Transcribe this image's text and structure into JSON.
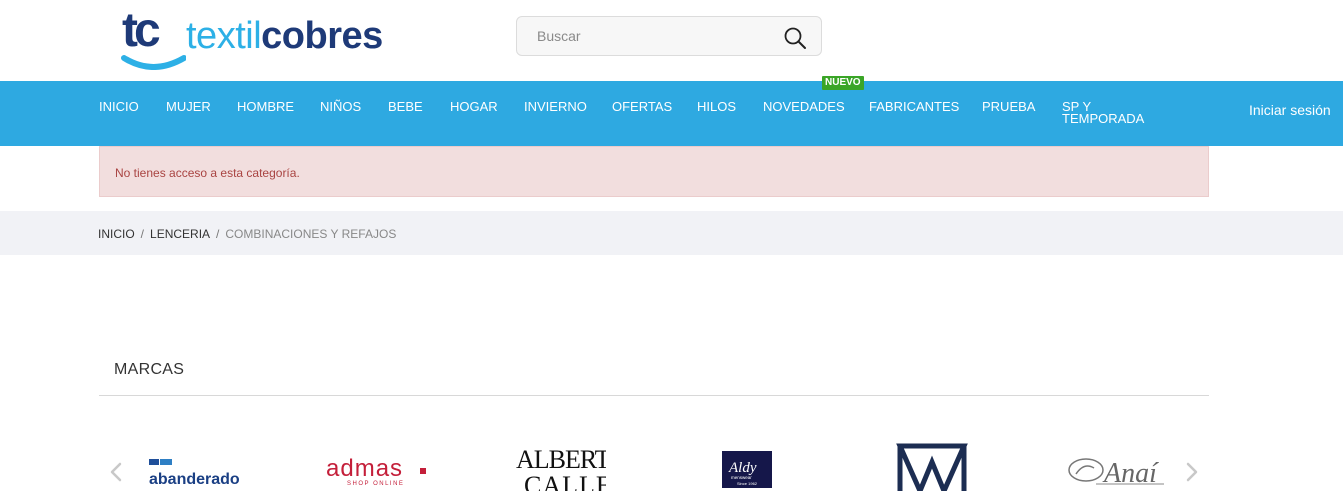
{
  "header": {
    "logo": {
      "monogram": "tc",
      "text_part1": "textil",
      "text_part2": "cobres"
    },
    "search": {
      "placeholder": "Buscar",
      "icon": "search-icon"
    }
  },
  "nav": {
    "items": [
      {
        "label": "INICIO"
      },
      {
        "label": "MUJER"
      },
      {
        "label": "HOMBRE"
      },
      {
        "label": "NIÑOS"
      },
      {
        "label": "BEBE"
      },
      {
        "label": "HOGAR"
      },
      {
        "label": "INVIERNO"
      },
      {
        "label": "OFERTAS"
      },
      {
        "label": "HILOS"
      },
      {
        "label": "NOVEDADES"
      },
      {
        "label": "FABRICANTES"
      },
      {
        "label": "PRUEBA"
      },
      {
        "label": "SP Y TEMPORADA"
      }
    ],
    "badge": "NUEVO",
    "login_label": "Iniciar sesión",
    "colors": {
      "bar": "#2ea9e1",
      "badge": "#3aa527"
    }
  },
  "alert": {
    "message": "No tienes acceso a esta categoría."
  },
  "breadcrumb": {
    "items": [
      "INICIO",
      "LENCERIA",
      "COMBINACIONES Y REFAJOS"
    ],
    "separator": "/"
  },
  "brands": {
    "title": "MARCAS",
    "logos": [
      {
        "name": "abanderado"
      },
      {
        "name": "admas",
        "tagline": "SHOP ONLINE"
      },
      {
        "name": "ALBERT CALLE"
      },
      {
        "name": "Aldy",
        "tagline": "menswear",
        "since": "Since 1962"
      },
      {
        "name": "AM monogram"
      },
      {
        "name": "Anaí"
      }
    ],
    "prev_icon": "chevron-left-icon",
    "next_icon": "chevron-right-icon"
  }
}
